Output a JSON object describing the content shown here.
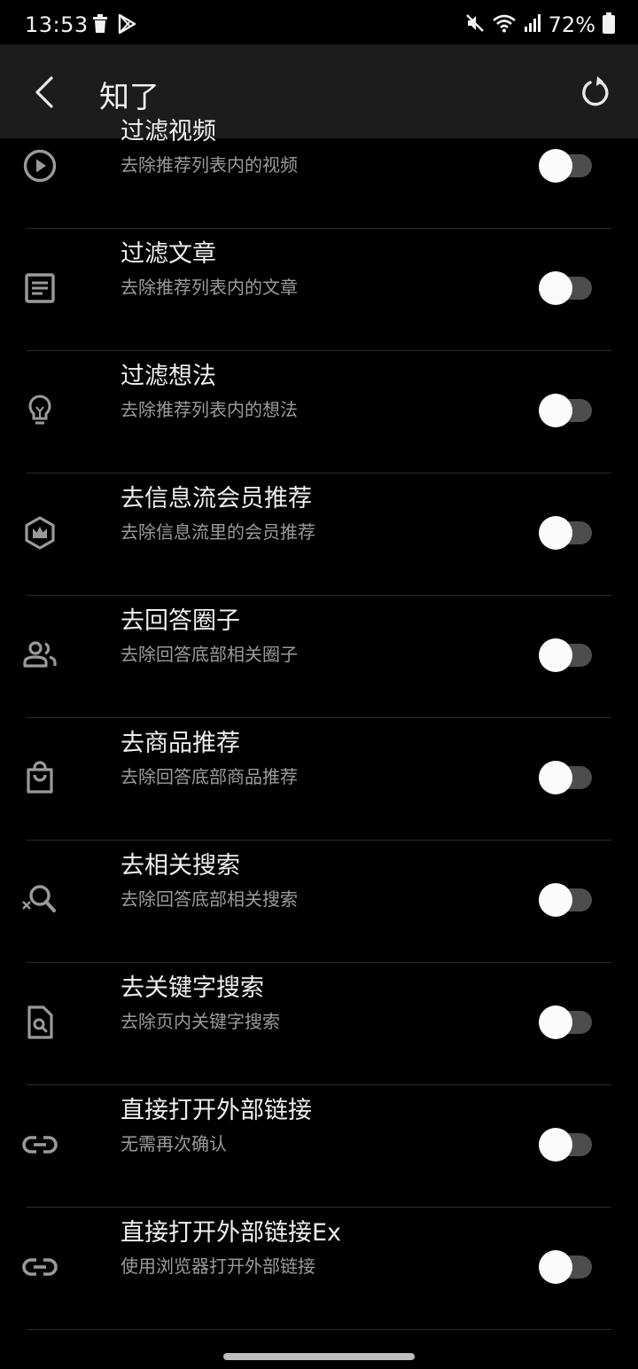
{
  "status_bar": {
    "time": "13:53",
    "battery": "72%",
    "left_icons": [
      "trash-icon",
      "play-store-icon"
    ],
    "right_icons": [
      "mute-icon",
      "wifi-icon",
      "signal-icon",
      "battery-icon"
    ]
  },
  "app_bar": {
    "title": "知了",
    "back_icon": "chevron-left-icon",
    "action_icon": "reset-icon"
  },
  "colors": {
    "background": "#000000",
    "app_bar": "#1c1c1c",
    "divider": "#2c2c2c",
    "toggle_track": "#4d4d4d",
    "toggle_knob": "#fbfbfb"
  },
  "settings": [
    {
      "icon": "play-circle-icon",
      "title": "过滤视频",
      "subtitle": "去除推荐列表内的视频",
      "enabled": false
    },
    {
      "icon": "article-icon",
      "title": "过滤文章",
      "subtitle": "去除推荐列表内的文章",
      "enabled": false
    },
    {
      "icon": "lightbulb-icon",
      "title": "过滤想法",
      "subtitle": "去除推荐列表内的想法",
      "enabled": false
    },
    {
      "icon": "crown-hexagon-icon",
      "title": "去信息流会员推荐",
      "subtitle": "去除信息流里的会员推荐",
      "enabled": false
    },
    {
      "icon": "people-icon",
      "title": "去回答圈子",
      "subtitle": "去除回答底部相关圈子",
      "enabled": false
    },
    {
      "icon": "shopping-bag-icon",
      "title": "去商品推荐",
      "subtitle": "去除回答底部商品推荐",
      "enabled": false
    },
    {
      "icon": "search-off-icon",
      "title": "去相关搜索",
      "subtitle": "去除回答底部相关搜索",
      "enabled": false
    },
    {
      "icon": "find-in-page-icon",
      "title": "去关键字搜索",
      "subtitle": "去除页内关键字搜索",
      "enabled": false
    },
    {
      "icon": "link-icon",
      "title": "直接打开外部链接",
      "subtitle": "无需再次确认",
      "enabled": false
    },
    {
      "icon": "link-icon",
      "title": "直接打开外部链接Ex",
      "subtitle": "使用浏览器打开外部链接",
      "enabled": false
    }
  ]
}
